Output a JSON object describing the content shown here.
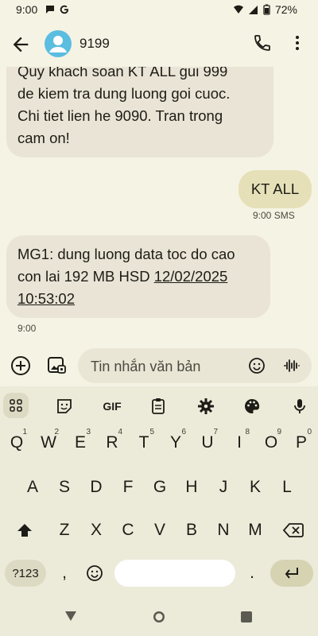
{
  "status_bar": {
    "time": "9:00",
    "battery": "72%"
  },
  "app_bar": {
    "contact_name": "9199"
  },
  "messages": [
    {
      "direction": "in",
      "lines": [
        "Quy khach soan KT ALL gui 999",
        "de kiem tra dung luong goi cuoc.",
        "Chi tiet lien he 9090. Tran trong",
        "cam on!"
      ]
    },
    {
      "direction": "out",
      "text": "KT ALL",
      "meta": "9:00 SMS"
    },
    {
      "direction": "in",
      "line1": "MG1: dung luong data toc do cao",
      "line2_prefix": "con lai 192 MB HSD ",
      "line2_link": "12/02/2025",
      "line3_link": "10:53:02",
      "meta": "9:00"
    }
  ],
  "compose": {
    "placeholder": "Tin nhắn văn bản"
  },
  "keyboard": {
    "toolbar": [
      "grid-icon",
      "sticker-icon",
      "GIF",
      "clipboard-icon",
      "gear-icon",
      "palette-icon",
      "mic-icon"
    ],
    "gif_label": "GIF",
    "row1": [
      "Q",
      "W",
      "E",
      "R",
      "T",
      "Y",
      "U",
      "I",
      "O",
      "P"
    ],
    "row1_hints": [
      "1",
      "2",
      "3",
      "4",
      "5",
      "6",
      "7",
      "8",
      "9",
      "0"
    ],
    "row2": [
      "A",
      "S",
      "D",
      "F",
      "G",
      "H",
      "J",
      "K",
      "L"
    ],
    "row3": [
      "Z",
      "X",
      "C",
      "V",
      "B",
      "N",
      "M"
    ],
    "symbols_label": "?123",
    "comma": ",",
    "period": "."
  },
  "colors": {
    "background": "#f5f3e4",
    "bubble_in": "#e9e4d5",
    "bubble_out": "#e6e0b8",
    "avatar": "#5bbde0"
  }
}
